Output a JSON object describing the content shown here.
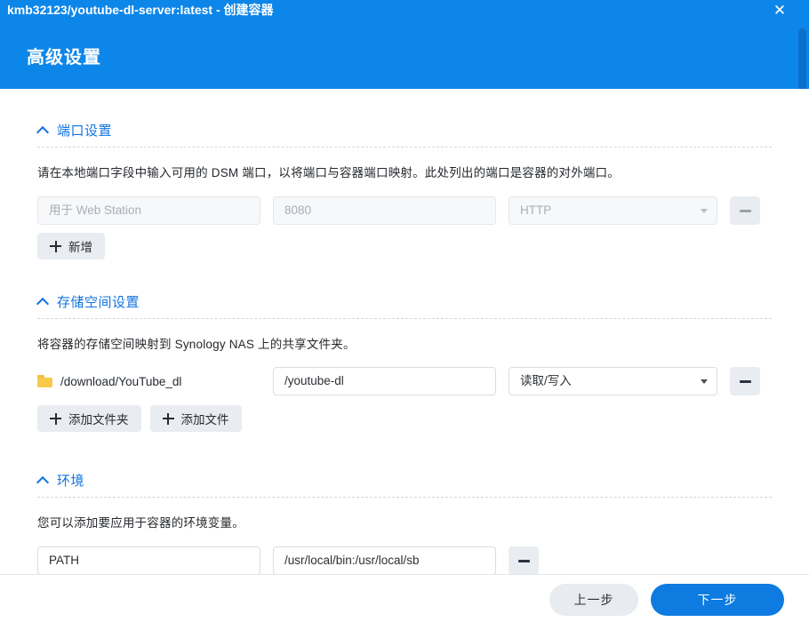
{
  "titlebar": {
    "title": "kmb32123/youtube-dl-server:latest - 创建容器",
    "close_label": "✕"
  },
  "dialog": {
    "heading": "高级设置"
  },
  "sections": {
    "port": {
      "title": "端口设置",
      "description": "请在本地端口字段中输入可用的 DSM 端口，以将端口与容器端口映射。此处列出的端口是容器的对外端口。",
      "row": {
        "local_placeholder": "用于 Web Station",
        "local_value": "",
        "container_placeholder": "8080",
        "container_value": "",
        "type_value": "HTTP",
        "remove_label": "−"
      },
      "add_label": "新增"
    },
    "storage": {
      "title": "存储空间设置",
      "description": "将容器的存储空间映射到 Synology NAS 上的共享文件夹。",
      "row": {
        "folder_path": "/download/YouTube_dl",
        "mount_path": "/youtube-dl",
        "permission": "读取/写入",
        "remove_label": "−"
      },
      "add_folder_label": "添加文件夹",
      "add_file_label": "添加文件"
    },
    "environment": {
      "title": "环境",
      "description": "您可以添加要应用于容器的环境变量。",
      "row": {
        "variable_name": "PATH",
        "variable_value": "/usr/local/bin:/usr/local/sb",
        "remove_label": "−"
      }
    }
  },
  "footer": {
    "prev_label": "上一步",
    "next_label": "下一步"
  },
  "colors": {
    "header_blue": "#0d86e9",
    "accent_blue": "#1273e0",
    "primary_button": "#0d7be0",
    "folder_yellow": "#f8c94a"
  }
}
